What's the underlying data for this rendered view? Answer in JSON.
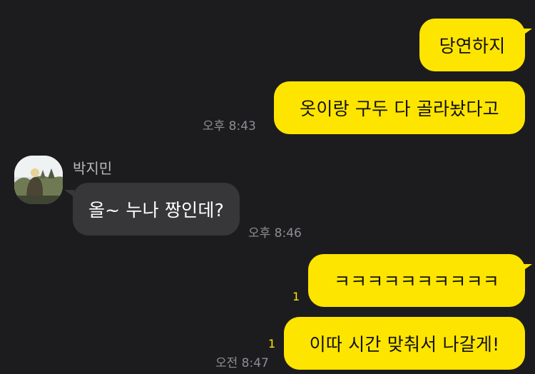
{
  "chat": {
    "messages": [
      {
        "text": "당연하지"
      },
      {
        "text": "옷이랑 구두 다 골라놨다고",
        "time": "오후 8:43"
      },
      {
        "sender": "박지민",
        "text": "올~ 누나 짱인데?",
        "time": "오후 8:46"
      },
      {
        "text": "ㅋㅋㅋㅋㅋㅋㅋㅋㅋㅋ",
        "unread": "1"
      },
      {
        "text": "이따 시간 맞춰서 나갈게!",
        "unread": "1",
        "time": "오전 8:47"
      }
    ]
  },
  "colors": {
    "background": "#1c1c1e",
    "my_bubble": "#fee500",
    "their_bubble": "#37373a",
    "timestamp": "#8e8e93",
    "unread": "#fee500"
  },
  "icons": {
    "avatar": "profile-photo-avatar"
  }
}
